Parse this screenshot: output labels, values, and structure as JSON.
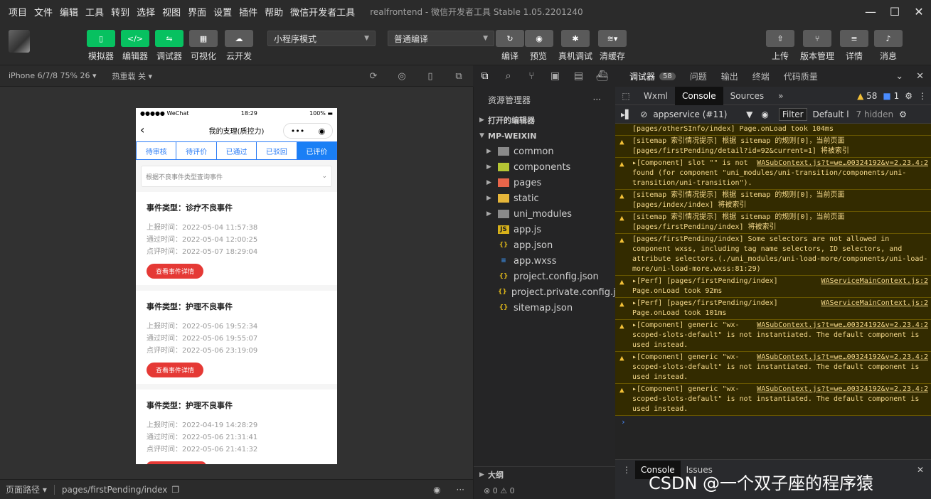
{
  "menu": [
    "项目",
    "文件",
    "编辑",
    "工具",
    "转到",
    "选择",
    "视图",
    "界面",
    "设置",
    "插件",
    "帮助",
    "微信开发者工具"
  ],
  "app_title": "realfrontend - 微信开发者工具 Stable 1.05.2201240",
  "toolbar": {
    "simulator": "模拟器",
    "editor": "编辑器",
    "debugger": "调试器",
    "visual": "可视化",
    "cloud": "云开发",
    "mode_select": "小程序模式",
    "compile_select": "普通编译",
    "compile": "编译",
    "preview": "预览",
    "real_debug": "真机调试",
    "clear_cache": "清缓存",
    "upload": "上传",
    "version": "版本管理",
    "detail": "详情",
    "message": "消息"
  },
  "simulator": {
    "device": "iPhone 6/7/8 75% 26 ▾",
    "hot_reload": "热重载 关 ▾",
    "route_label": "页面路径 ▾",
    "route": "pages/firstPending/index"
  },
  "phone": {
    "carrier": "●●●●● WeChat",
    "time": "18:29",
    "battery": "100%",
    "title": "我的支理(质控力)",
    "tabs": [
      "待审核",
      "待评价",
      "已通过",
      "已驳回",
      "已评价"
    ],
    "active_tab": 4,
    "filter_placeholder": "根据不良事件类型查询事件",
    "cards": [
      {
        "title": "事件类型：诊疗不良事件",
        "report": "上报时间：2022-05-04 11:57:38",
        "pass": "通过时间：2022-05-04 12:00:25",
        "review": "点评时间：2022-05-07 18:29:04",
        "button": "查看事件详情"
      },
      {
        "title": "事件类型：护理不良事件",
        "report": "上报时间：2022-05-06 19:52:34",
        "pass": "通过时间：2022-05-06 19:55:07",
        "review": "点评时间：2022-05-06 23:19:09",
        "button": "查看事件详情"
      },
      {
        "title": "事件类型：护理不良事件",
        "report": "上报时间：2022-04-19 14:28:29",
        "pass": "通过时间：2022-05-06 21:31:41",
        "review": "点评时间：2022-05-06 21:41:32",
        "button": ""
      }
    ]
  },
  "explorer": {
    "header": "资源管理器",
    "more": "···",
    "open_editors": "打开的编辑器",
    "root": "MP-WEIXIN",
    "folders": [
      "common",
      "components",
      "pages",
      "static",
      "uni_modules"
    ],
    "files": [
      "app.js",
      "app.json",
      "app.wxss",
      "project.config.json",
      "project.private.config.js...",
      "sitemap.json"
    ],
    "outline": "大纲",
    "problems": "⊗ 0 ⚠ 0"
  },
  "debugger": {
    "tabs": [
      "调试器",
      "问题",
      "输出",
      "终端",
      "代码质量"
    ],
    "badge": "58",
    "devtabs": [
      "Wxml",
      "Console",
      "Sources"
    ],
    "warn_count": "58",
    "info_count": "1",
    "context": "appservice (#11)",
    "filter": "Filter",
    "level": "Default l",
    "hidden": "7 hidden",
    "drawer_tabs": [
      "Console",
      "Issues"
    ]
  },
  "console": [
    {
      "text": "[pages/otherSInfo/index] Page.onLoad took 104ms",
      "src": ""
    },
    {
      "text": "[sitemap 索引情况提示] 根据 sitemap 的规则[0]，当前页面 [pages/firstPending/detail?id=92&current=1] 将被索引",
      "src": ""
    },
    {
      "text": "▸[Component] slot \"\" is not found (for component \"uni_modules/uni-transition/components/uni-transition/uni-transition\").",
      "src": "WASubContext.js?t=we…00324192&v=2.23.4:2"
    },
    {
      "text": "[sitemap 索引情况提示] 根据 sitemap 的规则[0]，当前页面 [pages/index/index] 将被索引",
      "src": ""
    },
    {
      "text": "[sitemap 索引情况提示] 根据 sitemap 的规则[0]，当前页面 [pages/firstPending/index] 将被索引",
      "src": ""
    },
    {
      "text": "[pages/firstPending/index] Some selectors are not allowed in component wxss, including tag name selectors, ID selectors, and attribute selectors.(./uni_modules/uni-load-more/components/uni-load-more/uni-load-more.wxss:81:29)",
      "src": ""
    },
    {
      "text": "▸[Perf] [pages/firstPending/index] Page.onLoad took 92ms",
      "src": "WAServiceMainContext.js:2"
    },
    {
      "text": "▸[Perf] [pages/firstPending/index] Page.onLoad took 101ms",
      "src": "WAServiceMainContext.js:2"
    },
    {
      "text": "▸[Component] generic \"wx-scoped-slots-default\" is not instantiated. The default component is used instead.",
      "src": "WASubContext.js?t=we…00324192&v=2.23.4:2"
    },
    {
      "text": "▸[Component] generic \"wx-scoped-slots-default\" is not instantiated. The default component is used instead.",
      "src": "WASubContext.js?t=we…00324192&v=2.23.4:2"
    },
    {
      "text": "▸[Component] generic \"wx-scoped-slots-default\" is not instantiated. The default component is used instead.",
      "src": "WASubContext.js?t=we…00324192&v=2.23.4:2"
    }
  ],
  "watermark": "CSDN @一个双子座的程序猿",
  "colors": {
    "green": "#07c160",
    "blue": "#1a7ff5",
    "red": "#e53935",
    "warn_bg": "#332b00"
  }
}
